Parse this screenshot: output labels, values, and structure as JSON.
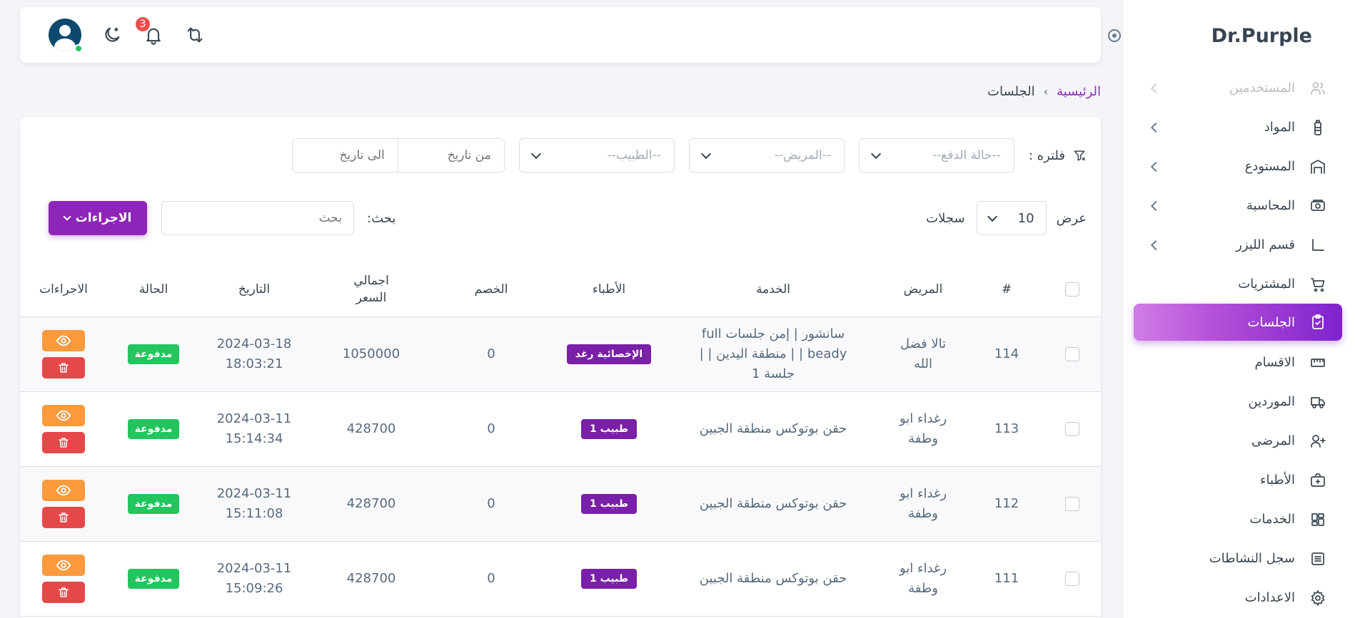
{
  "brand": {
    "name": "Dr.Purple"
  },
  "sidebar": {
    "items": [
      {
        "label": "المستخدمين",
        "icon": "users-icon",
        "has_children": true
      },
      {
        "label": "المواد",
        "icon": "bottle-icon",
        "has_children": true
      },
      {
        "label": "المستودع",
        "icon": "warehouse-icon",
        "has_children": true
      },
      {
        "label": "المحاسبة",
        "icon": "cash-icon",
        "has_children": true
      },
      {
        "label": "قسم الليزر",
        "icon": "laser-icon",
        "has_children": true
      },
      {
        "label": "المشتريات",
        "icon": "cart-icon",
        "has_children": false
      },
      {
        "label": "الجلسات",
        "icon": "clipboard-icon",
        "has_children": false,
        "active": true
      },
      {
        "label": "الاقسام",
        "icon": "ruler-icon",
        "has_children": false
      },
      {
        "label": "الموردين",
        "icon": "truck-icon",
        "has_children": false
      },
      {
        "label": "المرضى",
        "icon": "user-plus-icon",
        "has_children": false
      },
      {
        "label": "الأطباء",
        "icon": "medical-case-icon",
        "has_children": false
      },
      {
        "label": "الخدمات",
        "icon": "grid-icon",
        "has_children": false
      },
      {
        "label": "سجل النشاطات",
        "icon": "list-icon",
        "has_children": false
      },
      {
        "label": "الاعدادات",
        "icon": "gear-icon",
        "has_children": false
      }
    ]
  },
  "navbar": {
    "notifications_count": "3"
  },
  "breadcrumb": {
    "home": "الرئيسية",
    "separator": "›",
    "current": "الجلسات"
  },
  "filters": {
    "label": "فلتره :",
    "payment_status_placeholder": "--حالة الدفع--",
    "patient_placeholder": "--المريض--",
    "doctor_placeholder": "--الطبيب--",
    "from_date_placeholder": "من تاريخ",
    "to_date_placeholder": "الى تاريخ"
  },
  "controls": {
    "show_label": "عرض",
    "page_length": "10",
    "records_label": "سجلات",
    "search_label": "بحث:",
    "search_placeholder": "بحث",
    "actions_button": "الاجراءات"
  },
  "table": {
    "headers": {
      "num": "#",
      "patient": "المريض",
      "service": "الخدمة",
      "doctors": "الأطباء",
      "discount": "الخصم",
      "total": "اجمالي السعر",
      "date": "التاريخ",
      "status": "الحالة",
      "actions": "الاجراءات"
    },
    "rows": [
      {
        "num": "114",
        "patient": "تالا فضل الله",
        "service": "سانشور | إمن جلسات full beady | | منطقة اليدين | | جلسة 1",
        "doctor": "الإخصائية رغد",
        "discount": "0",
        "total": "1050000",
        "date": "2024-03-18",
        "time": "18:03:21",
        "status": "مدفوعة"
      },
      {
        "num": "113",
        "patient": "رغداء ابو وطفة",
        "service": "حقن بوتوكس منطقة الجبين",
        "doctor": "طبيب 1",
        "discount": "0",
        "total": "428700",
        "date": "2024-03-11",
        "time": "15:14:34",
        "status": "مدفوعة"
      },
      {
        "num": "112",
        "patient": "رغداء ابو وطفة",
        "service": "حقن بوتوكس منطقة الجبين",
        "doctor": "طبيب 1",
        "discount": "0",
        "total": "428700",
        "date": "2024-03-11",
        "time": "15:11:08",
        "status": "مدفوعة"
      },
      {
        "num": "111",
        "patient": "رغداء ابو وطفة",
        "service": "حقن بوتوكس منطقة الجبين",
        "doctor": "طبيب 1",
        "discount": "0",
        "total": "428700",
        "date": "2024-03-11",
        "time": "15:09:26",
        "status": "مدفوعة"
      }
    ]
  },
  "colors": {
    "primary": "#8e25b8",
    "success": "#22c55e",
    "warning": "#fb9a3c",
    "danger": "#e54848"
  }
}
